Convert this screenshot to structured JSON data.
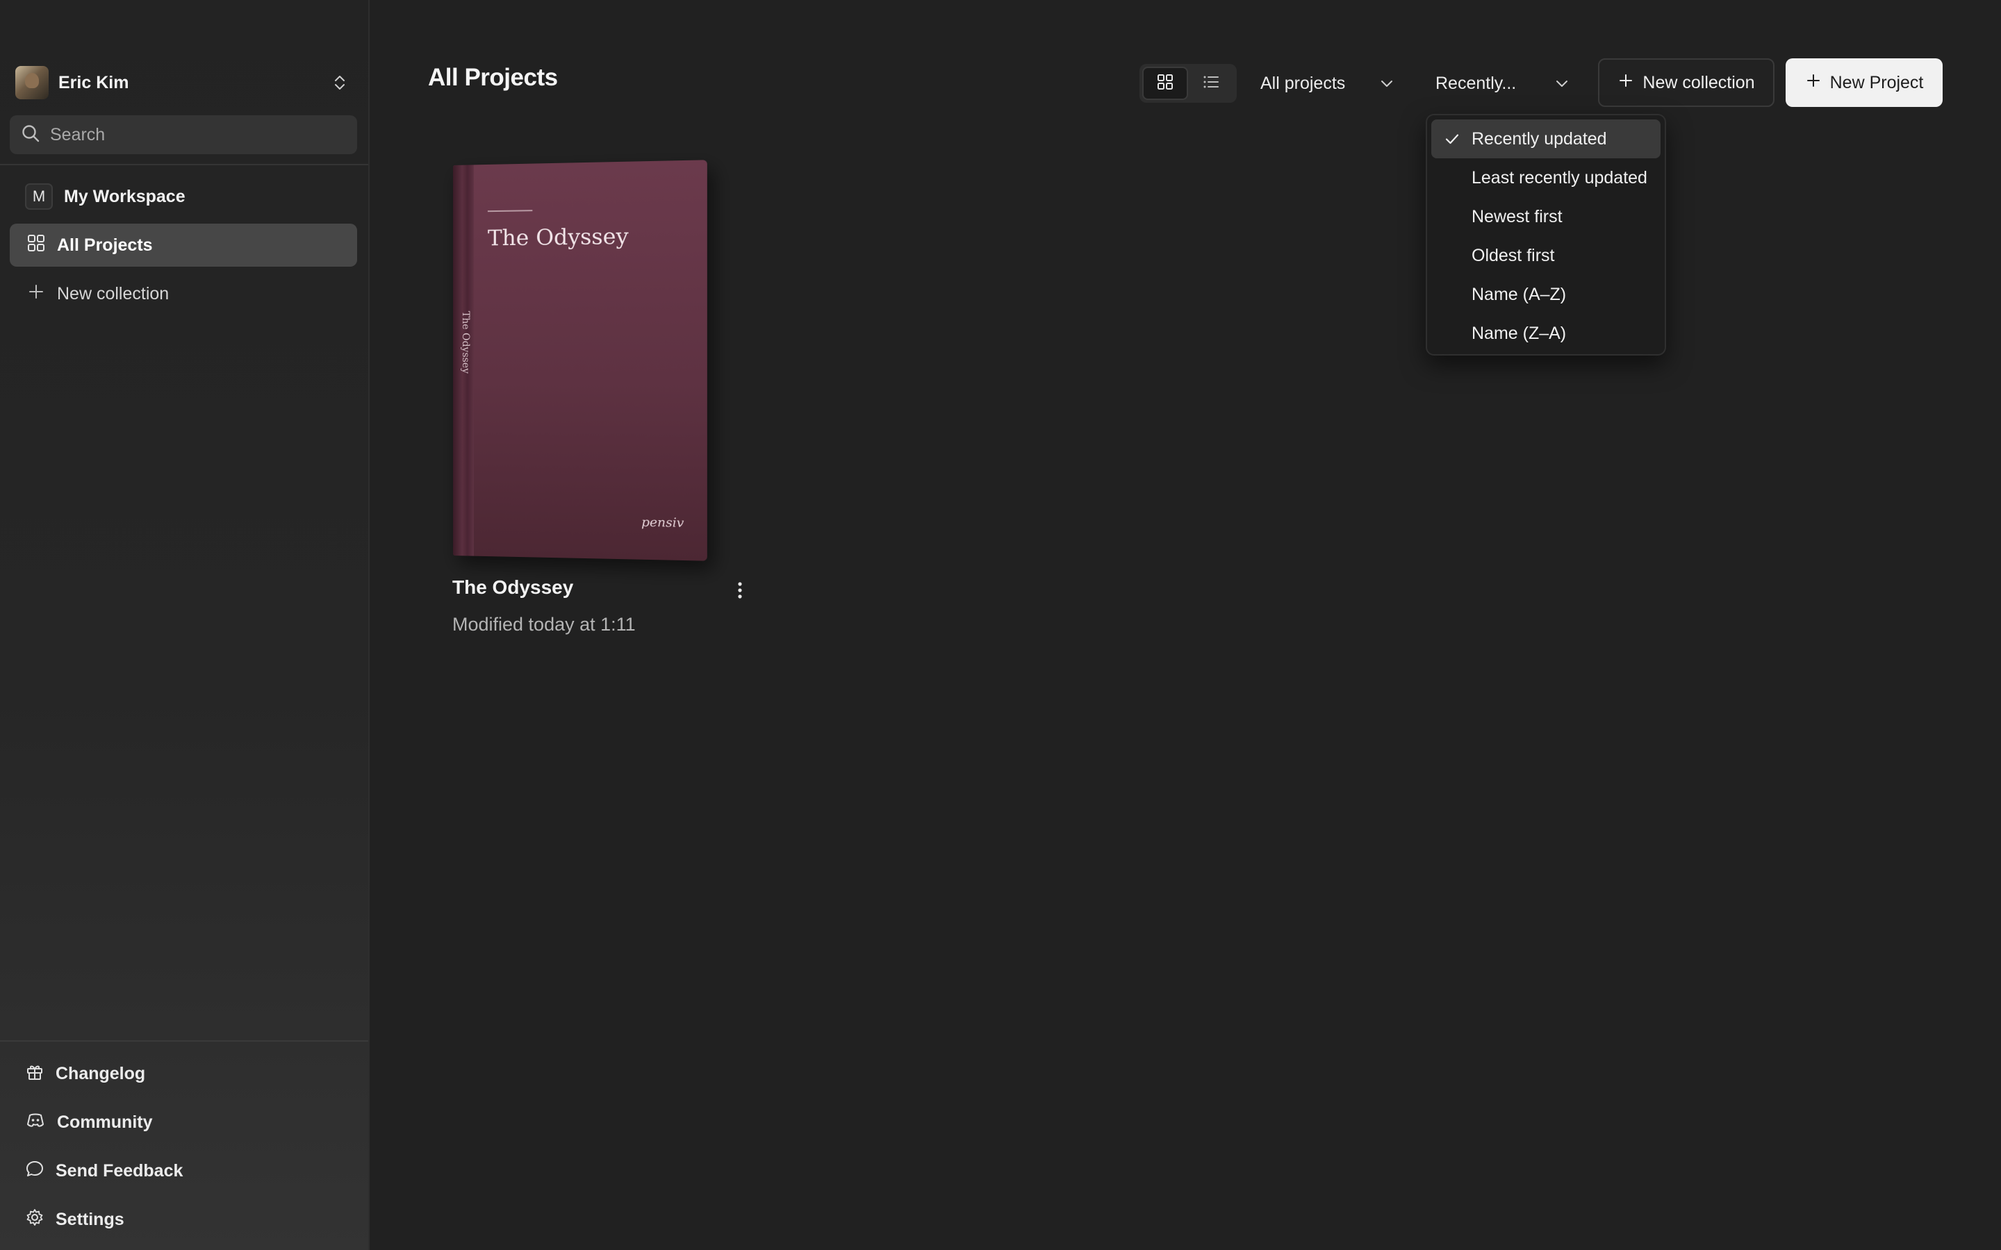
{
  "sidebar": {
    "user_name": "Eric Kim",
    "search_placeholder": "Search",
    "workspace": {
      "badge": "M",
      "name": "My Workspace"
    },
    "nav": {
      "all_projects": "All Projects",
      "new_collection": "New collection"
    },
    "footer": {
      "changelog": "Changelog",
      "community": "Community",
      "send_feedback": "Send Feedback",
      "settings": "Settings"
    }
  },
  "header": {
    "title": "All Projects",
    "filter_label": "All projects",
    "sort_label": "Recently...",
    "new_collection_label": "New collection",
    "new_project_label": "New Project"
  },
  "sort_menu": {
    "selected": "Recently updated",
    "options": [
      "Recently updated",
      "Least recently updated",
      "Newest first",
      "Oldest first",
      "Name (A–Z)",
      "Name (Z–A)"
    ]
  },
  "projects": [
    {
      "title": "The Odyssey",
      "modified": "Modified today at 1:11",
      "cover": {
        "title": "The Odyssey",
        "spine": "The Odyssey",
        "publisher": "pensiv",
        "color": "#5e3242"
      }
    }
  ],
  "colors": {
    "background": "#212121",
    "sidebar": "#262626",
    "active_nav": "#474747",
    "primary_button": "#f1f1f1",
    "menu_bg": "#1d1d1d"
  },
  "icons": {
    "user_switcher": "chevron-updown-icon",
    "search": "search-icon",
    "all_projects": "grid-icon",
    "new_collection": "plus-icon",
    "changelog": "gift-icon",
    "community": "discord-icon",
    "send_feedback": "message-icon",
    "settings": "gear-icon",
    "grid_view": "grid-icon",
    "list_view": "list-icon",
    "dropdown": "chevron-down-icon",
    "card_menu": "more-vertical-icon",
    "selected_check": "check-icon"
  }
}
